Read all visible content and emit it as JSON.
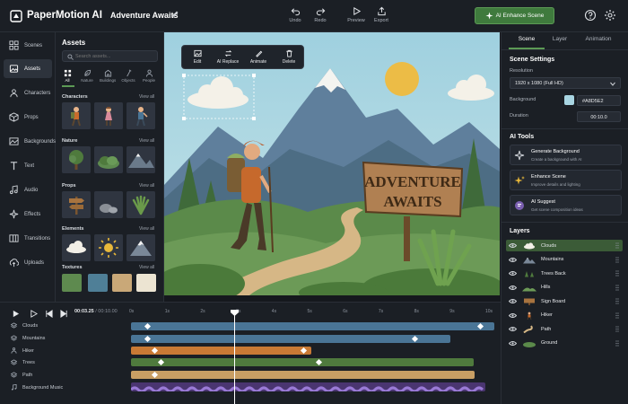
{
  "app": {
    "name": "PaperMotion AI",
    "project_title": "Adventure Awaits"
  },
  "toolbar": {
    "undo": "Undo",
    "redo": "Redo",
    "preview": "Preview",
    "export": "Export",
    "enhance_label": "AI Enhance Scene"
  },
  "sidebar": {
    "items": [
      {
        "label": "Scenes",
        "icon": "scenes-icon"
      },
      {
        "label": "Assets",
        "icon": "assets-icon",
        "active": true
      },
      {
        "label": "Characters",
        "icon": "characters-icon"
      },
      {
        "label": "Props",
        "icon": "props-icon"
      },
      {
        "label": "Backgrounds",
        "icon": "backgrounds-icon"
      },
      {
        "label": "Text",
        "icon": "text-icon"
      },
      {
        "label": "Audio",
        "icon": "audio-icon"
      },
      {
        "label": "Effects",
        "icon": "effects-icon"
      },
      {
        "label": "Transitions",
        "icon": "transitions-icon"
      },
      {
        "label": "Uploads",
        "icon": "uploads-icon"
      }
    ]
  },
  "assets": {
    "title": "Assets",
    "search_placeholder": "Search assets...",
    "filters": [
      "All",
      "Nature",
      "Buildings",
      "Objects",
      "People"
    ],
    "view_all": "View all",
    "sections": {
      "characters": "Characters",
      "nature": "Nature",
      "props": "Props",
      "elements": "Elements",
      "textures": "Textures"
    },
    "texture_colors": [
      "#5e8a4f",
      "#4f7f97",
      "#c9a878",
      "#ece4d2"
    ]
  },
  "canvas": {
    "edit_toolbar": [
      "Edit",
      "AI Replace",
      "Animate",
      "Delete"
    ],
    "sign_line1": "ADVENTURE",
    "sign_line2": "AWAITS"
  },
  "right_panel": {
    "tabs": [
      "Scene",
      "Layer",
      "Animation"
    ],
    "scene_settings": {
      "title": "Scene Settings",
      "resolution_label": "Resolution",
      "resolution_value": "1920 x 1080 (Full HD)",
      "background_label": "Background",
      "background_hex": "#A8D5E2",
      "duration_label": "Duration",
      "duration_value": "00:10.0"
    },
    "ai_tools": {
      "title": "AI Tools",
      "cards": [
        {
          "title": "Generate Background",
          "subtitle": "Create a background with AI"
        },
        {
          "title": "Enhance Scene",
          "subtitle": "Improve details and lighting"
        },
        {
          "title": "AI Suggest",
          "subtitle": "Get scene composition ideas"
        }
      ]
    },
    "layers": {
      "title": "Layers",
      "items": [
        "Clouds",
        "Mountains",
        "Trees Back",
        "Hills",
        "Sign Board",
        "Hiker",
        "Path",
        "Ground"
      ]
    }
  },
  "timeline": {
    "current_time": "00:03.25",
    "total_time": "/ 00:10.00",
    "ticks": [
      "0s",
      "1s",
      "2s",
      "3s",
      "4s",
      "5s",
      "6s",
      "7s",
      "8s",
      "9s",
      "10s"
    ],
    "tracks": [
      "Clouds",
      "Mountains",
      "Hiker",
      "Trees",
      "Path",
      "Background Music"
    ]
  },
  "colors": {
    "accent": "#5c9a55",
    "clip_blue": "#4a7596",
    "clip_orange": "#c97a35",
    "clip_green": "#4f7a3d",
    "clip_tan": "#c89e64",
    "clip_audio": "#5e3f8a"
  }
}
